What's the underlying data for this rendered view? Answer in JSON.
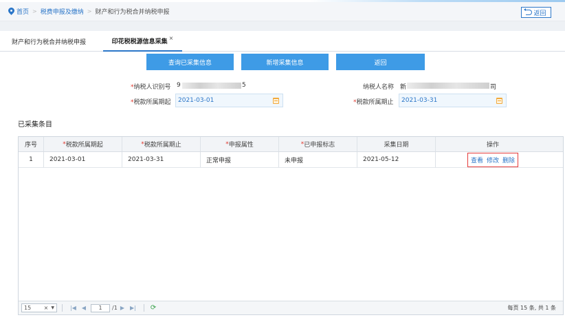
{
  "breadcrumb": {
    "home": "首页",
    "level1": "税费申报及缴纳",
    "current": "财产和行为税合并纳税申报",
    "back_label": "返回"
  },
  "tabs": [
    {
      "label": "财产和行为税合并纳税申报"
    },
    {
      "label": "印花税税源信息采集",
      "close": "×"
    }
  ],
  "actions": {
    "query_label": "查询已采集信息",
    "add_label": "新增采集信息",
    "return_label": "返回"
  },
  "form": {
    "taxpayer_id_label": "纳税人识别号",
    "taxpayer_id_prefix": "9",
    "taxpayer_id_suffix": "5",
    "taxpayer_name_label": "纳税人名称",
    "taxpayer_name_prefix": "新",
    "taxpayer_name_suffix": "司",
    "period_start_label": "税款所属期起",
    "period_start_value": "2021-03-01",
    "period_end_label": "税款所属期止",
    "period_end_value": "2021-03-31",
    "required_mark": "*"
  },
  "section_title": "已采集条目",
  "table": {
    "headers": [
      "序号",
      "税款所属期起",
      "税款所属期止",
      "申报属性",
      "已申报标志",
      "采集日期",
      "操作"
    ],
    "rows": [
      {
        "index": "1",
        "period_start": "2021-03-01",
        "period_end": "2021-03-31",
        "declare_attr": "正常申报",
        "declared_flag": "未申报",
        "collect_date": "2021-05-12",
        "ops": {
          "view": "查看",
          "edit": "修改",
          "delete": "删除"
        }
      }
    ]
  },
  "pager": {
    "page_size": "15",
    "page_size_clear": "×",
    "current_page": "1",
    "total_pages": "/1",
    "info": "每页 15 条, 共 1 条"
  },
  "colors": {
    "accent": "#2b76c8",
    "button": "#3e9be6",
    "required": "#e0362c",
    "highlight_box": "#e43a3a"
  }
}
